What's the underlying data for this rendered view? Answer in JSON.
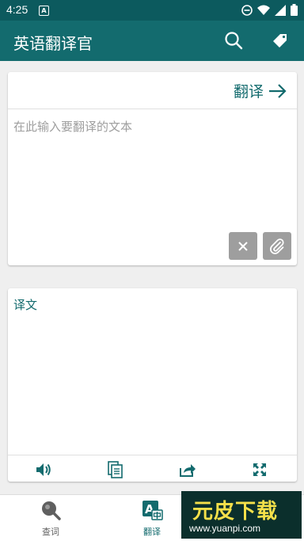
{
  "status_bar": {
    "time": "4:25",
    "notification_letter": "A"
  },
  "app_bar": {
    "title": "英语翻译官"
  },
  "input_card": {
    "translate_label": "翻译",
    "placeholder": "在此输入要翻译的文本"
  },
  "result_card": {
    "label": "译文"
  },
  "bottom_nav": {
    "items": [
      {
        "label": "查词",
        "icon": "magnifier-icon"
      },
      {
        "label": "翻译",
        "icon": "translate-icon",
        "active": true
      }
    ]
  },
  "watermark": {
    "title": "元皮下载",
    "url": "www.yuanpi.com"
  },
  "colors": {
    "primary": "#136b6e",
    "status_bar": "#0c5a5e",
    "background": "#efefef",
    "gray_button": "#9e9e9e"
  }
}
